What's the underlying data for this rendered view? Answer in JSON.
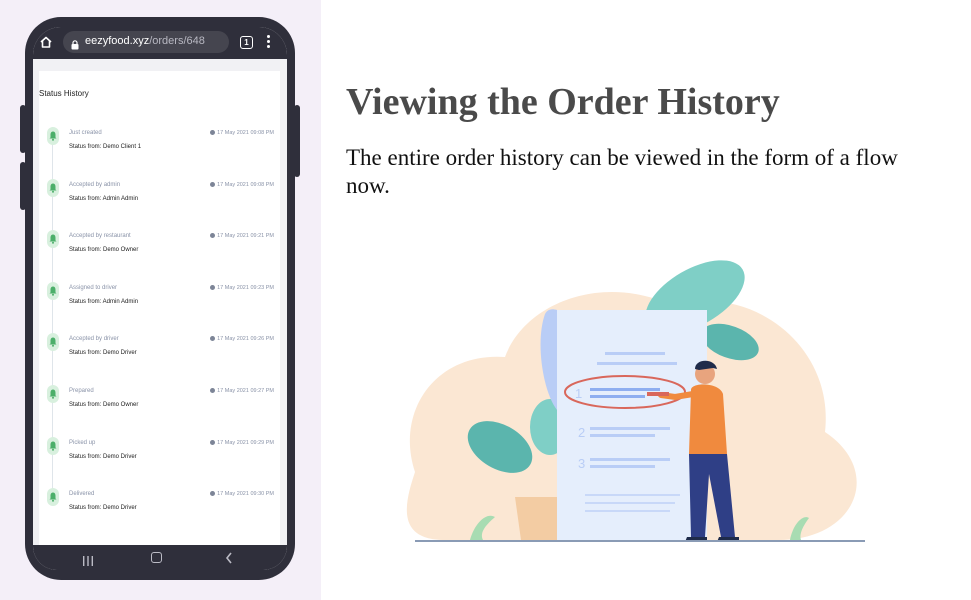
{
  "browser": {
    "url_domain": "eezyfood.xyz",
    "url_path": "/orders/648",
    "tab_count": "1",
    "icons": [
      "home-icon",
      "lock-icon",
      "tabs-icon",
      "kebab-menu-icon"
    ]
  },
  "status_history": {
    "title": "Status History",
    "items": [
      {
        "label": "Just created",
        "sub": "Status from: Demo Client 1",
        "time": "17 May 2021 09:08 PM"
      },
      {
        "label": "Accepted by admin",
        "sub": "Status from: Admin Admin",
        "time": "17 May 2021 09:08 PM"
      },
      {
        "label": "Accepted by restaurant",
        "sub": "Status from: Demo Owner",
        "time": "17 May 2021 09:21 PM"
      },
      {
        "label": "Assigned to driver",
        "sub": "Status from: Admin Admin",
        "time": "17 May 2021 09:23 PM"
      },
      {
        "label": "Accepted by driver",
        "sub": "Status from: Demo Driver",
        "time": "17 May 2021 09:26 PM"
      },
      {
        "label": "Prepared",
        "sub": "Status from: Demo Owner",
        "time": "17 May 2021 09:27 PM"
      },
      {
        "label": "Picked up",
        "sub": "Status from: Demo Driver",
        "time": "17 May 2021 09:29 PM"
      },
      {
        "label": "Delivered",
        "sub": "Status from: Demo Driver",
        "time": "17 May 2021 09:30 PM"
      }
    ]
  },
  "android_nav": {
    "icons": [
      "recent-apps-icon",
      "home-circle-icon",
      "back-icon"
    ]
  },
  "promo": {
    "title": "Viewing the Order History",
    "description": "The entire order history can be viewed in the form of a flow now."
  },
  "illustration": {
    "step_numbers": [
      "1",
      "2",
      "3"
    ]
  },
  "colors": {
    "left_panel_bg": "#f4eff8",
    "phone_frame": "#2f2f3b",
    "status_dot": "#4caf6a",
    "status_dot_bg": "#d8f0de",
    "headline": "#4a4a4a"
  }
}
